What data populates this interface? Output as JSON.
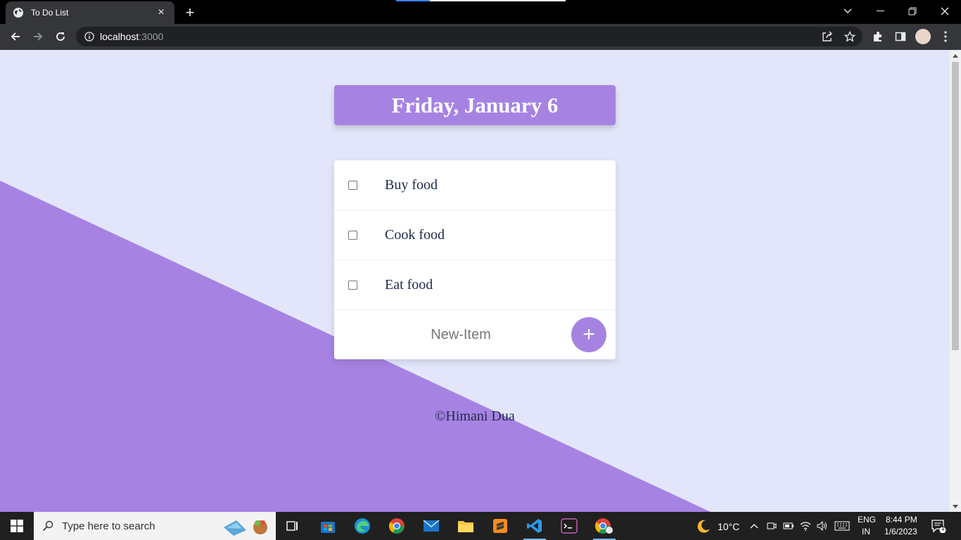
{
  "browser": {
    "tab_title": "To Do List",
    "tab_close": "×",
    "new_tab": "+",
    "url_host": "localhost",
    "url_port": ":3000"
  },
  "page": {
    "heading": "Friday, January 6",
    "items": [
      {
        "label": "Buy food",
        "checked": false
      },
      {
        "label": "Cook food",
        "checked": false
      },
      {
        "label": "Eat food",
        "checked": false
      }
    ],
    "new_item_placeholder": "New-Item",
    "add_button_label": "+",
    "footer": "©Himani Dua"
  },
  "colors": {
    "accent": "#a683e3",
    "page_background": "#e3e6fb",
    "text": "#1e2a4a"
  },
  "taskbar": {
    "search_placeholder": "Type here to search",
    "weather_temp": "10°C",
    "language": "ENG",
    "region": "IN",
    "time": "8:44 PM",
    "date": "1/6/2023",
    "notification_count": "1"
  }
}
